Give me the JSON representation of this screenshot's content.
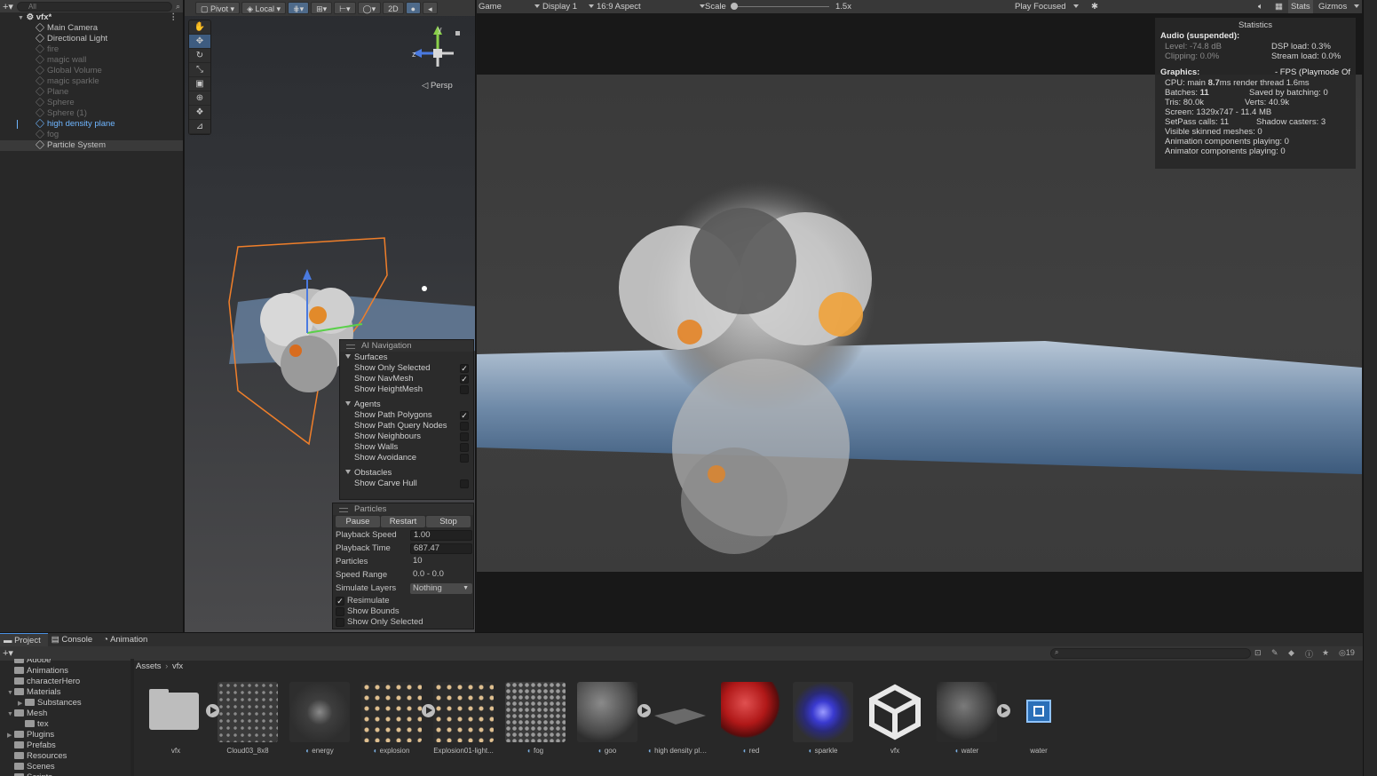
{
  "hierarchy": {
    "search_placeholder": "All",
    "scene_name": "vfx*",
    "items": [
      {
        "label": "Main Camera",
        "state": "normal"
      },
      {
        "label": "Directional Light",
        "state": "normal"
      },
      {
        "label": "fire",
        "state": "dim"
      },
      {
        "label": "magic wall",
        "state": "dim"
      },
      {
        "label": "Global Volume",
        "state": "dim"
      },
      {
        "label": "magic sparkle",
        "state": "dim"
      },
      {
        "label": "Plane",
        "state": "dim"
      },
      {
        "label": "Sphere",
        "state": "dim"
      },
      {
        "label": "Sphere (1)",
        "state": "dim"
      },
      {
        "label": "high density plane",
        "state": "selected"
      },
      {
        "label": "fog",
        "state": "dim"
      },
      {
        "label": "Particle System",
        "state": "highlight"
      }
    ]
  },
  "scene_toolbar": {
    "pivot": "Pivot",
    "local": "Local",
    "mode_2d": "2D"
  },
  "scene_gizmo": {
    "y": "y",
    "z": "z",
    "projection": "Persp"
  },
  "ai_navigation": {
    "title": "AI Navigation",
    "surfaces_label": "Surfaces",
    "surfaces": [
      {
        "label": "Show Only Selected",
        "checked": true
      },
      {
        "label": "Show NavMesh",
        "checked": true
      },
      {
        "label": "Show HeightMesh",
        "checked": false
      }
    ],
    "agents_label": "Agents",
    "agents": [
      {
        "label": "Show Path Polygons",
        "checked": true
      },
      {
        "label": "Show Path Query Nodes",
        "checked": false
      },
      {
        "label": "Show Neighbours",
        "checked": false
      },
      {
        "label": "Show Walls",
        "checked": false
      },
      {
        "label": "Show Avoidance",
        "checked": false
      }
    ],
    "obstacles_label": "Obstacles",
    "obstacles": [
      {
        "label": "Show Carve Hull",
        "checked": false
      }
    ]
  },
  "particles": {
    "title": "Particles",
    "pause": "Pause",
    "restart": "Restart",
    "stop": "Stop",
    "playback_speed_label": "Playback Speed",
    "playback_speed": "1.00",
    "playback_time_label": "Playback Time",
    "playback_time": "687.47",
    "particles_label": "Particles",
    "particles": "10",
    "speed_range_label": "Speed Range",
    "speed_range": "0.0 - 0.0",
    "simulate_layers_label": "Simulate Layers",
    "simulate_layers": "Nothing",
    "checks": [
      {
        "label": "Resimulate",
        "checked": true
      },
      {
        "label": "Show Bounds",
        "checked": false
      },
      {
        "label": "Show Only Selected",
        "checked": false
      }
    ]
  },
  "game_toolbar": {
    "view": "Game",
    "display": "Display 1",
    "aspect": "16:9 Aspect",
    "scale_label": "Scale",
    "scale_value": "1.5x",
    "scale_fraction": 0.0,
    "play_mode": "Play Focused",
    "stats": "Stats",
    "gizmos": "Gizmos"
  },
  "statistics": {
    "title": "Statistics",
    "audio_header": "Audio (suspended):",
    "level": "Level: -74.8 dB",
    "clipping": "Clipping: 0.0%",
    "dsp_load": "DSP load: 0.3%",
    "stream_load": "Stream load: 0.0%",
    "graphics_header": "Graphics:",
    "fps": "- FPS (Playmode Of",
    "cpu_prefix": "CPU: main ",
    "cpu_main": "8.7",
    "cpu_suffix": "ms  render thread 1.6ms",
    "batches_prefix": "Batches: ",
    "batches": "11",
    "saved_batching": "Saved by batching: 0",
    "tris": "Tris: 80.0k",
    "verts": "Verts: 40.9k",
    "screen": "Screen: 1329x747 - 11.4 MB",
    "setpass": "SetPass calls: 11",
    "shadow_casters": "Shadow casters: 3",
    "skinned": "Visible skinned meshes: 0",
    "animation": "Animation components playing: 0",
    "animator": "Animator components playing: 0"
  },
  "project": {
    "tabs": [
      "Project",
      "Console",
      "Animation"
    ],
    "hidden_count": "19",
    "tree": [
      {
        "label": "Adobe",
        "depth": 1,
        "arrow": ""
      },
      {
        "label": "Animations",
        "depth": 1,
        "arrow": ""
      },
      {
        "label": "characterHero",
        "depth": 1,
        "arrow": ""
      },
      {
        "label": "Materials",
        "depth": 1,
        "arrow": "▼"
      },
      {
        "label": "Substances",
        "depth": 2,
        "arrow": "▶"
      },
      {
        "label": "Mesh",
        "depth": 1,
        "arrow": "▼"
      },
      {
        "label": "tex",
        "depth": 2,
        "arrow": ""
      },
      {
        "label": "Plugins",
        "depth": 1,
        "arrow": "▶"
      },
      {
        "label": "Prefabs",
        "depth": 1,
        "arrow": ""
      },
      {
        "label": "Resources",
        "depth": 1,
        "arrow": ""
      },
      {
        "label": "Scenes",
        "depth": 1,
        "arrow": ""
      },
      {
        "label": "Scripts",
        "depth": 1,
        "arrow": ""
      }
    ],
    "breadcrumb_root": "Assets",
    "breadcrumb_sep": "›",
    "breadcrumb_current": "vfx",
    "assets": [
      {
        "name": "vfx",
        "kind": "folder"
      },
      {
        "name": "Cloud03_8x8",
        "kind": "grid"
      },
      {
        "name": "energy",
        "kind": "energy"
      },
      {
        "name": "explosion",
        "kind": "sprites"
      },
      {
        "name": "Explosion01-light...",
        "kind": "sprites"
      },
      {
        "name": "fog",
        "kind": "fog"
      },
      {
        "name": "goo",
        "kind": "goo"
      },
      {
        "name": "high density plane",
        "kind": "plane"
      },
      {
        "name": "red",
        "kind": "red"
      },
      {
        "name": "sparkle",
        "kind": "sparkle"
      },
      {
        "name": "vfx",
        "kind": "unity"
      },
      {
        "name": "water",
        "kind": "water"
      },
      {
        "name": "water",
        "kind": "prefab"
      }
    ]
  },
  "colors": {
    "selection_blue": "#6fb6ff",
    "accent": "#4a90e2",
    "selection_outline": "#f07f2a"
  }
}
